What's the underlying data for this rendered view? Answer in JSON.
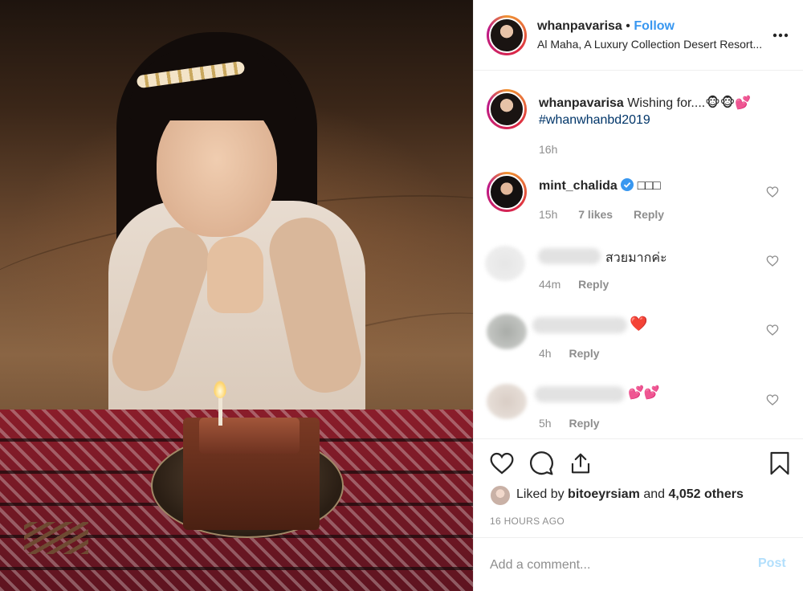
{
  "post": {
    "author": "whanpavarisa",
    "separator": "•",
    "follow_label": "Follow",
    "location": "Al Maha, A Luxury Collection Desert Resort...",
    "more_icon": "more-options-icon",
    "caption_text": "Wishing for....",
    "caption_emoji": "🐵🐵💕",
    "caption_hashtag": "#whanwhanbd2019",
    "caption_time": "16h"
  },
  "comments": [
    {
      "user": "mint_chalida",
      "verified": true,
      "text": "□□□",
      "time": "15h",
      "likes": "7 likes",
      "reply": "Reply"
    },
    {
      "user": "",
      "text": "สวยมากค่ะ",
      "time": "44m",
      "reply": "Reply"
    },
    {
      "user": "",
      "text": "❤️",
      "time": "4h",
      "reply": "Reply"
    },
    {
      "user": "",
      "text": "💕💕",
      "time": "5h",
      "reply": "Reply"
    }
  ],
  "actions": {
    "liked_by_prefix": "Liked by",
    "liked_by_user": "bitoeyrsiam",
    "liked_by_and": "and",
    "liked_by_others": "4,052 others",
    "posted_ago": "16 HOURS AGO"
  },
  "comment_box": {
    "placeholder": "Add a comment...",
    "post_label": "Post"
  },
  "colors": {
    "link_blue": "#3897f0",
    "post_disabled": "#b2dffc",
    "meta_gray": "#8e8e8e",
    "heart_red": "#ed4956"
  }
}
